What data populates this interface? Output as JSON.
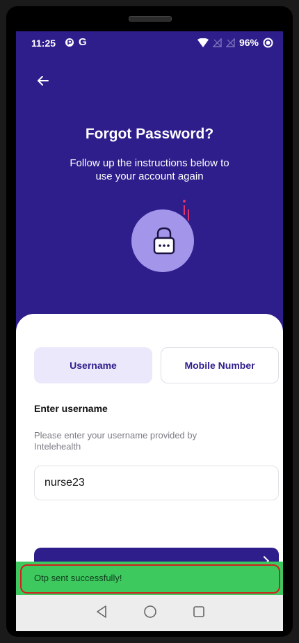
{
  "status_bar": {
    "time": "11:25",
    "battery": "96%",
    "icons": [
      "data-saver-icon",
      "google-icon",
      "wifi-icon",
      "no-signal-icon",
      "no-signal-icon",
      "battery-icon"
    ]
  },
  "header": {
    "back_icon": "arrow-left-icon",
    "title": "Forgot Password?",
    "subtitle": "Follow up the instructions below to use your account again",
    "illustration_icon": "lock-icon"
  },
  "tabs": [
    {
      "label": "Username",
      "selected": true
    },
    {
      "label": "Mobile Number",
      "selected": false
    }
  ],
  "form": {
    "label": "Enter username",
    "hint": "Please enter your username provided by Intelehealth",
    "username_value": "nurse23"
  },
  "toast": {
    "message": "Otp sent successfully!"
  },
  "nav": {
    "icons": [
      "back-triangle-icon",
      "home-circle-icon",
      "recents-square-icon"
    ]
  },
  "colors": {
    "primary": "#2e1e8c",
    "accent_light": "#a295ea",
    "toast_bg": "#3ec95f",
    "highlight": "#d21f1f"
  }
}
